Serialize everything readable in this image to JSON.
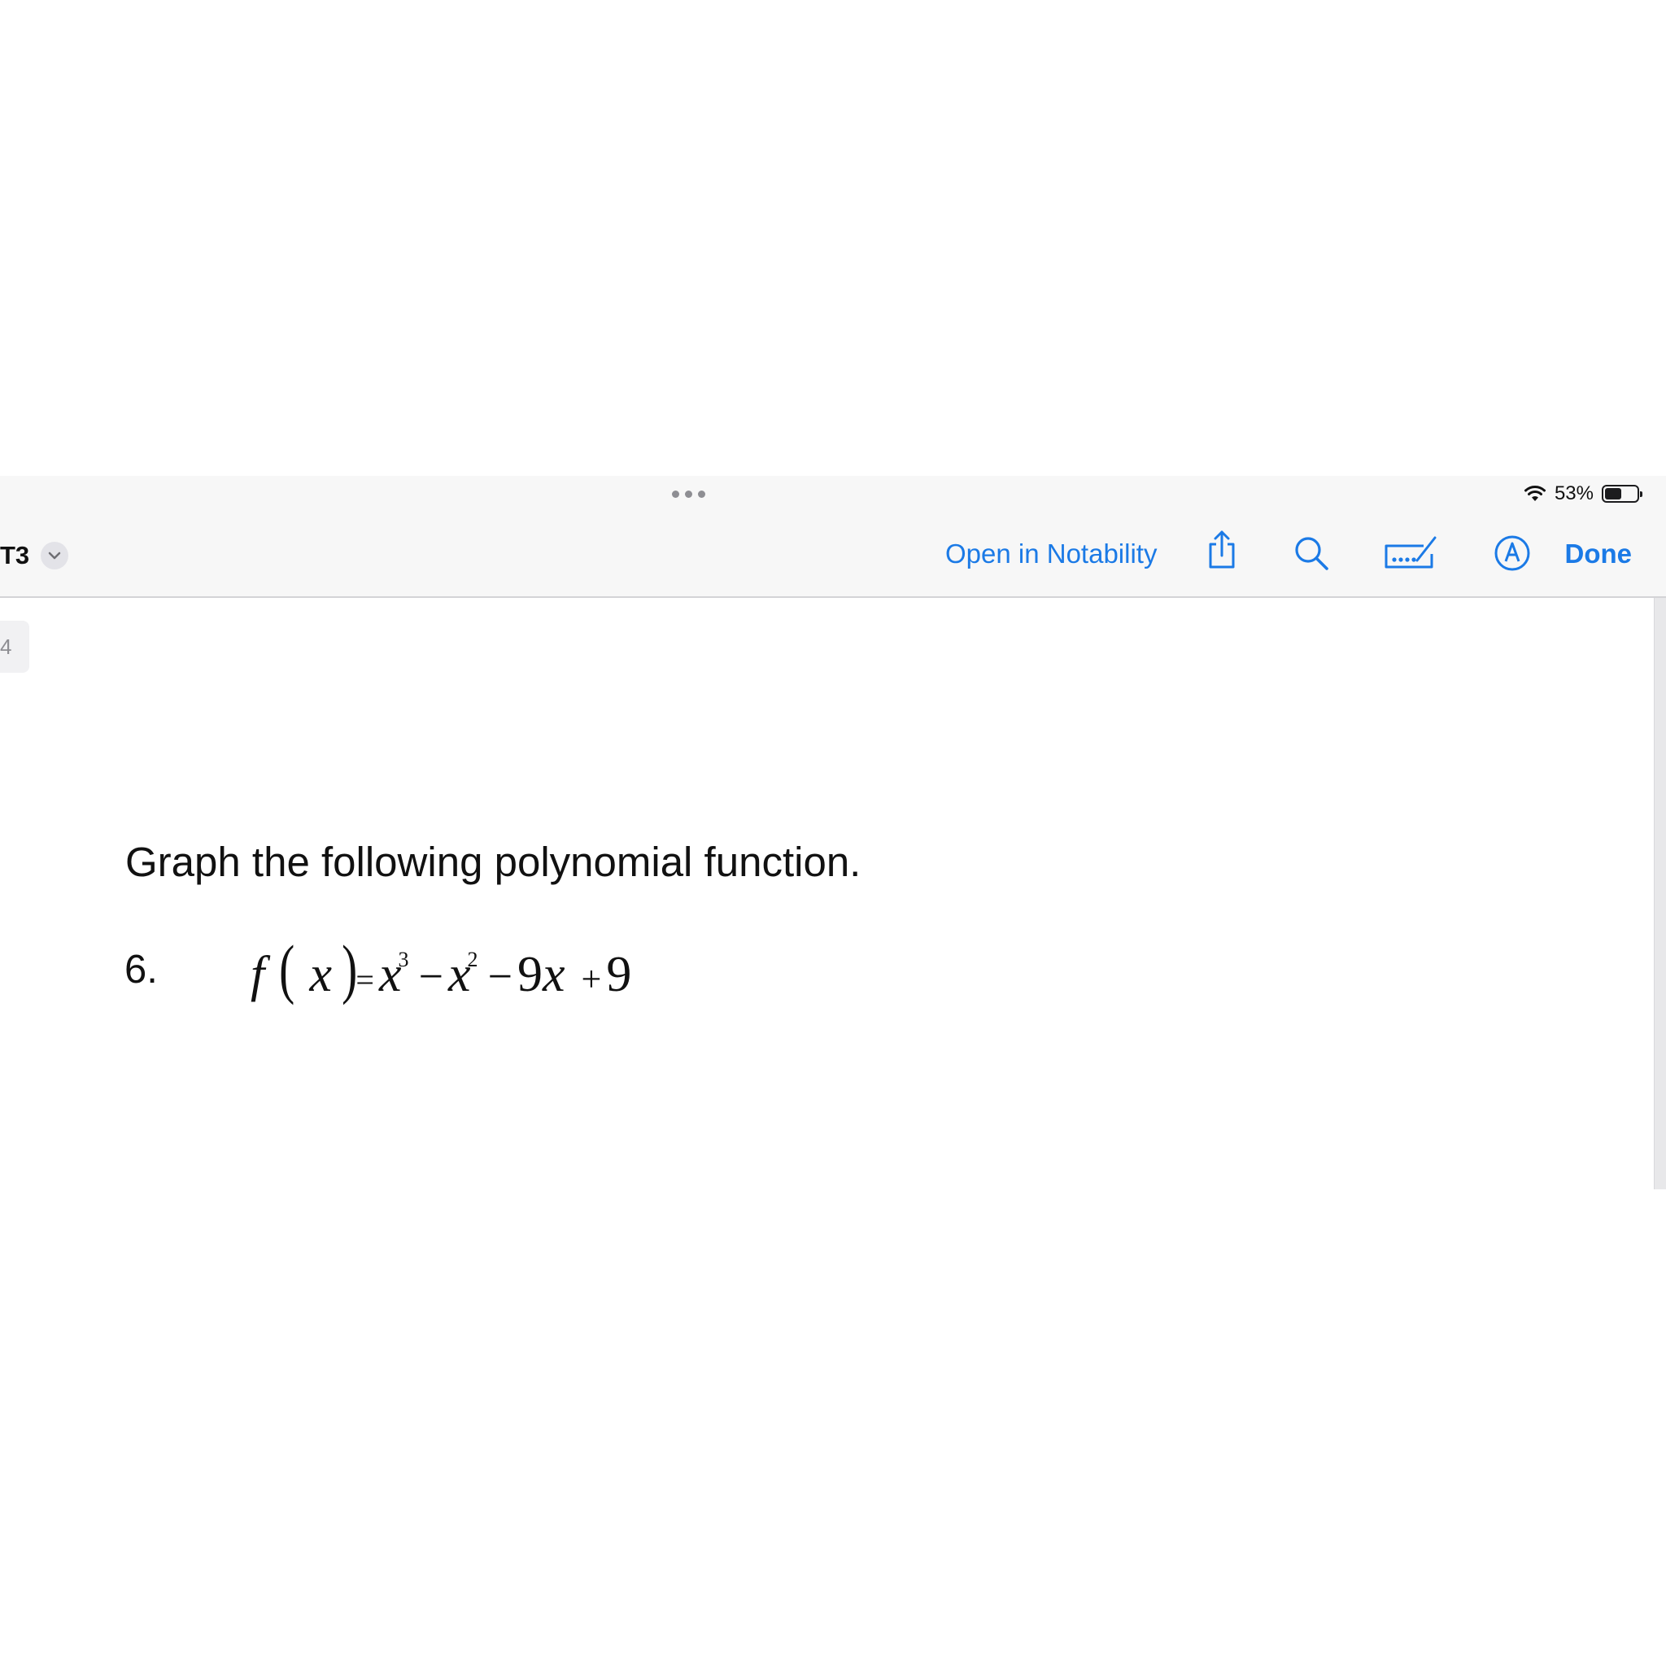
{
  "status": {
    "battery_percent_label": "53%",
    "battery_level": 0.53
  },
  "toolbar": {
    "title": "T3",
    "open_in_label": "Open in Notability",
    "done_label": "Done"
  },
  "sidebar": {
    "page_thumb_label": "4"
  },
  "document": {
    "instruction": "Graph the following polynomial function.",
    "problem_number": "6.",
    "equation": {
      "fname": "f",
      "lparen": "(",
      "var": "x",
      "rparen": ")",
      "eq": "=",
      "term1_base": "x",
      "term1_exp": "3",
      "minus1": "−",
      "term2_base": "x",
      "term2_exp": "2",
      "minus2": "−",
      "term3_coef": "9",
      "term3_var": "x",
      "plus": "+",
      "constant": "9"
    }
  },
  "colors": {
    "accent": "#1b7ae6",
    "toolbar_bg": "#f7f7f7"
  },
  "icons": {
    "share": "share-icon",
    "search": "search-icon",
    "markup_form": "form-fill-icon",
    "markup": "markup-pen-icon",
    "wifi": "wifi-icon",
    "chevron": "chevron-down-icon"
  }
}
